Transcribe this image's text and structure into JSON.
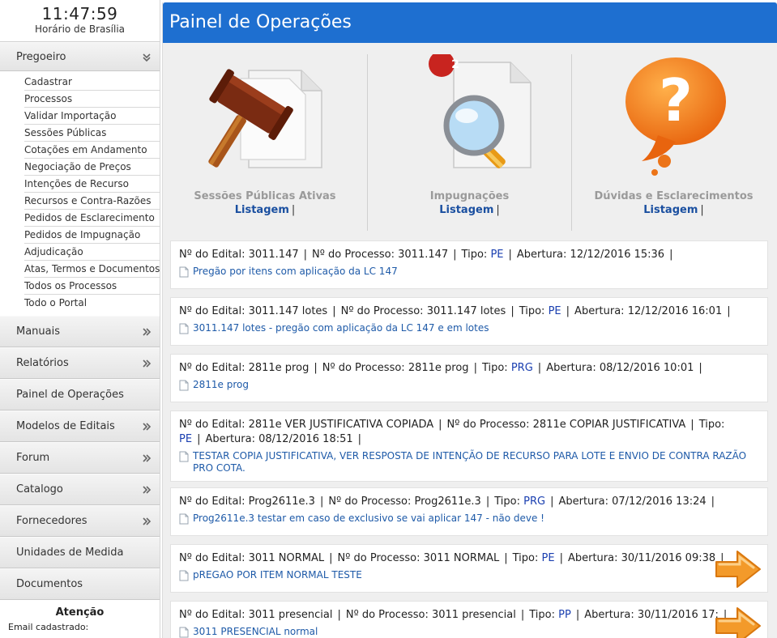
{
  "clock": {
    "time": "11:47:59",
    "label": "Horário de Brasília"
  },
  "sidebar": {
    "pregoeiro": {
      "label": "Pregoeiro",
      "items": [
        "Cadastrar",
        "Processos",
        "Validar Importação",
        "Sessões Públicas",
        "Cotações em Andamento",
        "Negociação de Preços",
        "Intenções de Recurso",
        "Recursos e Contra-Razões",
        "Pedidos de Esclarecimento",
        "Pedidos de Impugnação",
        "Adjudicação",
        "Atas, Termos e Documentos",
        "Todos os Processos",
        "Todo o Portal"
      ]
    },
    "menu": [
      {
        "label": "Manuais",
        "has_arrow": true
      },
      {
        "label": "Relatórios",
        "has_arrow": true
      },
      {
        "label": "Painel de Operações",
        "has_arrow": false
      },
      {
        "label": "Modelos de Editais",
        "has_arrow": true
      },
      {
        "label": "Forum",
        "has_arrow": true
      },
      {
        "label": "Catalogo",
        "has_arrow": true
      },
      {
        "label": "Fornecedores",
        "has_arrow": true
      },
      {
        "label": "Unidades de Medida",
        "has_arrow": false
      },
      {
        "label": "Documentos",
        "has_arrow": false
      }
    ],
    "atencao": {
      "title": "Atenção",
      "text": "Email cadastrado:"
    }
  },
  "main": {
    "title": "Painel de Operações",
    "panels": [
      {
        "title": "Sessões Públicas Ativas",
        "link": "Listagem",
        "icon": "gavel-document-icon"
      },
      {
        "title": "Impugnações",
        "link": "Listagem",
        "icon": "magnifier-document-icon",
        "badge": "2"
      },
      {
        "title": "Dúvidas e Esclarecimentos",
        "link": "Listagem",
        "icon": "question-bubble-icon"
      }
    ],
    "labels": {
      "edital": "Nº do Edital:",
      "processo": "Nº do Processo:",
      "tipo": "Tipo:",
      "abertura": "Abertura:"
    },
    "items": [
      {
        "edital": "3011.147",
        "processo": "3011.147",
        "tipo": "PE",
        "abertura": "12/12/2016 15:36",
        "descricao": "Pregão por itens com aplicação da LC 147"
      },
      {
        "edital": "3011.147 lotes",
        "processo": "3011.147 lotes",
        "tipo": "PE",
        "abertura": "12/12/2016 16:01",
        "descricao": "3011.147 lotes - pregão com aplicação da LC 147 e em lotes"
      },
      {
        "edital": "2811e prog",
        "processo": "2811e prog",
        "tipo": "PRG",
        "abertura": "08/12/2016 10:01",
        "descricao": "2811e prog"
      },
      {
        "edital": "2811e VER JUSTIFICATIVA COPIADA",
        "processo": "2811e COPIAR JUSTIFICATIVA",
        "tipo": "PE",
        "abertura": "08/12/2016 18:51",
        "descricao": "TESTAR COPIA JUSTIFICATIVA, VER RESPOSTA DE INTENÇÃO DE RECURSO PARA LOTE E ENVIO DE CONTRA RAZÃO PRO COTA."
      },
      {
        "edital": "Prog2611e.3",
        "processo": "Prog2611e.3",
        "tipo": "PRG",
        "abertura": "07/12/2016 13:24",
        "descricao": "Prog2611e.3 testar em caso de exclusivo se vai aplicar 147 - não deve !"
      },
      {
        "edital": "3011 NORMAL",
        "processo": "3011 NORMAL",
        "tipo": "PE",
        "abertura": "30/11/2016 09:38",
        "descricao": "pREGAO POR ITEM NORMAL TESTE",
        "arrow": true
      },
      {
        "edital": "3011 presencial",
        "processo": "3011 presencial",
        "tipo": "PP",
        "abertura": "30/11/2016 17:",
        "descricao": "3011 PRESENCIAL normal",
        "arrow": true
      }
    ]
  }
}
